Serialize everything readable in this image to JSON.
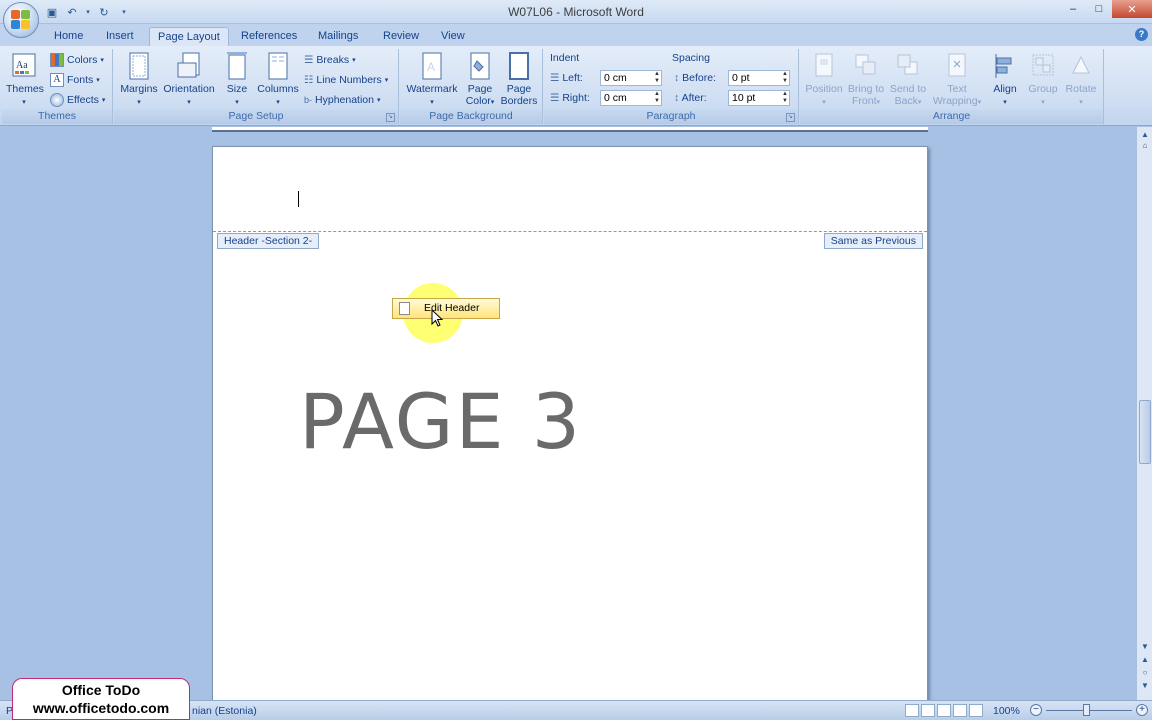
{
  "window": {
    "title": "W07L06 - Microsoft Word",
    "minimize": "–",
    "maximize": "□",
    "close": "✕"
  },
  "tabs": [
    {
      "label": "Home"
    },
    {
      "label": "Insert"
    },
    {
      "label": "Page Layout",
      "active": true
    },
    {
      "label": "References"
    },
    {
      "label": "Mailings"
    },
    {
      "label": "Review"
    },
    {
      "label": "View"
    }
  ],
  "ribbon": {
    "themes": {
      "group_label": "Themes",
      "themes_label": "Themes",
      "colors_label": "Colors",
      "fonts_label": "Fonts",
      "effects_label": "Effects"
    },
    "page_setup": {
      "group_label": "Page Setup",
      "margins_label": "Margins",
      "orientation_label": "Orientation",
      "size_label": "Size",
      "columns_label": "Columns",
      "breaks_label": "Breaks",
      "line_numbers_label": "Line Numbers",
      "hyphenation_label": "Hyphenation"
    },
    "page_background": {
      "group_label": "Page Background",
      "watermark_label": "Watermark",
      "page_color_label_1": "Page",
      "page_color_label_2": "Color",
      "page_borders_label_1": "Page",
      "page_borders_label_2": "Borders"
    },
    "paragraph": {
      "group_label": "Paragraph",
      "indent_label": "Indent",
      "left_label": "Left:",
      "left_value": "0 cm",
      "right_label": "Right:",
      "right_value": "0 cm",
      "spacing_label": "Spacing",
      "before_label": "Before:",
      "before_value": "0 pt",
      "after_label": "After:",
      "after_value": "10 pt"
    },
    "arrange": {
      "group_label": "Arrange",
      "position_label": "Position",
      "bring_to_front_1": "Bring to",
      "bring_to_front_2": "Front",
      "send_to_back_1": "Send to",
      "send_to_back_2": "Back",
      "text_wrapping_1": "Text",
      "text_wrapping_2": "Wrapping",
      "align_label": "Align",
      "group_btn_label": "Group",
      "rotate_label": "Rotate"
    }
  },
  "document": {
    "header_tag": "Header -Section 2-",
    "same_as_previous": "Same as Previous",
    "edit_header_label": "Edit Header",
    "page_text": "PAGE 3"
  },
  "statusbar": {
    "page_prefix": "P",
    "language": "nian (Estonia)",
    "zoom": "100%"
  },
  "brand": {
    "line1": "Office ToDo",
    "line2": "www.officetodo.com"
  },
  "colors": {
    "ribbon_bg": "#dbe7f6",
    "doc_bg": "#a6c1e3",
    "edit_header_bg": "#ffe47a",
    "highlight": "#ffff00"
  }
}
